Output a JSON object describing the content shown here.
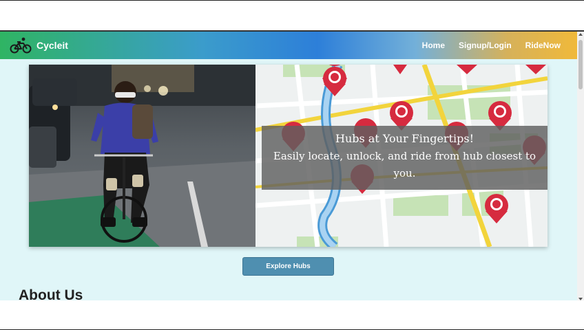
{
  "navbar": {
    "brand_name": "Cycleit",
    "links": [
      "Home",
      "Signup/Login",
      "RideNow"
    ],
    "logo_icon": "bicycle-icon"
  },
  "hero": {
    "caption_title": "Hubs at Your Fingertips!",
    "caption_text": "Easily locate, unlock, and ride from hub closest to you."
  },
  "explore_button": {
    "label": "Explore Hubs"
  },
  "about": {
    "title": "About Us"
  },
  "colors": {
    "page_bg": "#e0f6f8",
    "button_bg": "#4f8fb0",
    "map_pin": "#d62b3f",
    "nav_gradient_start": "#2fb463",
    "nav_gradient_end": "#f0b93a"
  }
}
